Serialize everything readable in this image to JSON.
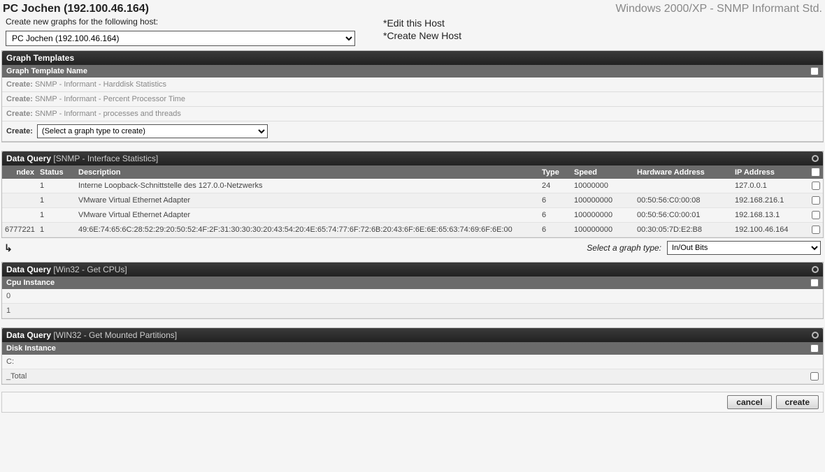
{
  "header": {
    "title": "PC Jochen (192.100.46.164)",
    "rightTitle": "Windows 2000/XP - SNMP Informant Std."
  },
  "subheader": {
    "label": "Create new graphs for the following host:",
    "hostSelected": "PC Jochen (192.100.46.164)",
    "editLink": "*Edit this Host",
    "createLink": "*Create New Host"
  },
  "graphTemplates": {
    "barTitle": "Graph Templates",
    "colHeader": "Graph Template Name",
    "rows": [
      {
        "prefix": "Create:",
        "name": "SNMP - Informant - Harddisk Statistics"
      },
      {
        "prefix": "Create:",
        "name": "SNMP - Informant - Percent Processor Time"
      },
      {
        "prefix": "Create:",
        "name": "SNMP - Informant - processes and threads"
      }
    ],
    "createLabel": "Create:",
    "createSelectValue": "(Select a graph type to create)"
  },
  "ifaceQuery": {
    "barPrefix": "Data Query",
    "barSuffix": "[SNMP - Interface Statistics]",
    "cols": {
      "index": "ndex",
      "status": "Status",
      "desc": "Description",
      "type": "Type",
      "speed": "Speed",
      "hw": "Hardware Address",
      "ip": "IP Address"
    },
    "rows": [
      {
        "index": "",
        "status": "1",
        "desc": "Interne Loopback-Schnittstelle des 127.0.0-Netzwerks",
        "type": "24",
        "speed": "10000000",
        "hw": "",
        "ip": "127.0.0.1"
      },
      {
        "index": "",
        "status": "1",
        "desc": "VMware Virtual Ethernet Adapter",
        "type": "6",
        "speed": "100000000",
        "hw": "00:50:56:C0:00:08",
        "ip": "192.168.216.1"
      },
      {
        "index": "",
        "status": "1",
        "desc": "VMware Virtual Ethernet Adapter",
        "type": "6",
        "speed": "100000000",
        "hw": "00:50:56:C0:00:01",
        "ip": "192.168.13.1"
      },
      {
        "index": "6777221",
        "status": "1",
        "desc": "49:6E:74:65:6C:28:52:29:20:50:52:4F:2F:31:30:30:30:20:43:54:20:4E:65:74:77:6F:72:6B:20:43:6F:6E:6E:65:63:74:69:6F:6E:00",
        "type": "6",
        "speed": "100000000",
        "hw": "00:30:05:7D:E2:B8",
        "ip": "192.100.46.164"
      }
    ],
    "graphTypeLabel": "Select a graph type:",
    "graphTypeValue": "In/Out Bits"
  },
  "cpuQuery": {
    "barPrefix": "Data Query",
    "barSuffix": "[Win32 - Get CPUs]",
    "colHeader": "Cpu Instance",
    "rows": [
      "0",
      "1"
    ]
  },
  "diskQuery": {
    "barPrefix": "Data Query",
    "barSuffix": "[WIN32 - Get Mounted Partitions]",
    "colHeader": "Disk Instance",
    "rows": [
      "C:",
      "_Total"
    ]
  },
  "footer": {
    "cancel": "cancel",
    "create": "create"
  }
}
